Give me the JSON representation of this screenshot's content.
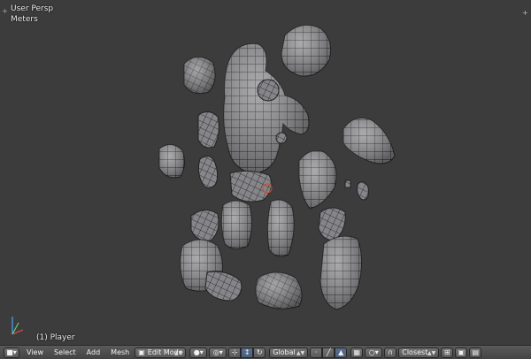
{
  "viewport": {
    "view_name": "User Persp",
    "units": "Meters",
    "object_label": "(1) Player",
    "mesh_color": "#8c8c90",
    "wire_color": "#1e1e1e"
  },
  "header": {
    "menus": [
      "View",
      "Select",
      "Add",
      "Mesh"
    ],
    "mode": "Edit Mode",
    "orientation": "Global",
    "snap_target": "Closest",
    "icons": {
      "editor_type": "cube-icon",
      "viewport_shading": "sphere-icon",
      "pivot": "pivot-icon",
      "manipulator": "manipulator-icon",
      "snap": "magnet-icon",
      "proportional": "circle-icon"
    }
  }
}
